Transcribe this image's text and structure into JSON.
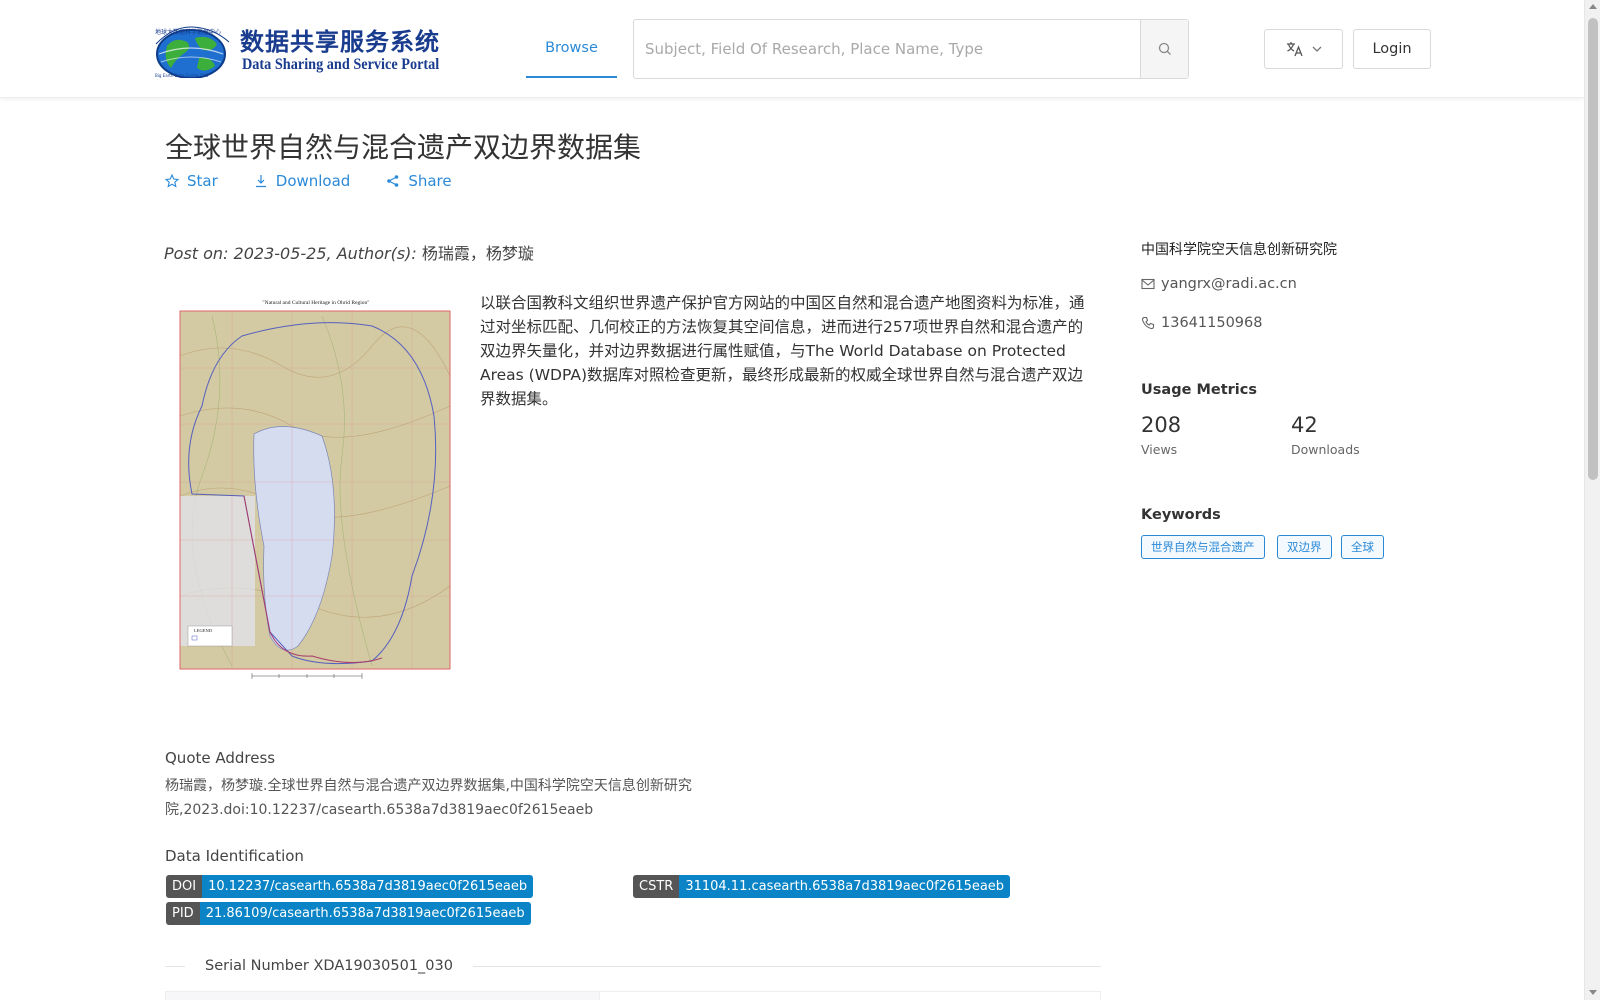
{
  "header": {
    "logo_cn": "数据共享服务系统",
    "logo_en": "Data Sharing and Service Portal",
    "logo_org": "Big Earth Data Center,CAS",
    "logo_org_cn": "地球大数据科学数据中心",
    "nav_browse": "Browse",
    "search_placeholder": "Subject, Field Of Research, Place Name, Type",
    "login": "Login"
  },
  "dataset": {
    "title": "全球世界自然与混合遗产双边界数据集",
    "actions": {
      "star": "Star",
      "download": "Download",
      "share": "Share"
    },
    "post_prefix": "Post on: 2023-05-25, Author(s):",
    "authors": "杨瑞霞，杨梦璇",
    "map_title": "\"Natural and Cultural Heritage in Ohrid Region\"",
    "map_legend": "LEGEND",
    "description": "以联合国教科文组织世界遗产保护官方网站的中国区自然和混合遗产地图资料为标准，通过对坐标匹配、几何校正的方法恢复其空间信息，进而进行257项世界自然和混合遗产的双边界矢量化，并对边界数据进行属性赋值，与The World Database on Protected Areas (WDPA)数据库对照检查更新，最终形成最新的权威全球世界自然与混合遗产双边界数据集。"
  },
  "quote": {
    "label": "Quote Address",
    "text": "杨瑞霞，杨梦璇.全球世界自然与混合遗产双边界数据集,中国科学院空天信息创新研究院,2023.doi:10.12237/casearth.6538a7d3819aec0f2615eaeb"
  },
  "identification": {
    "label": "Data Identification",
    "doi_key": "DOI",
    "doi_value": "10.12237/casearth.6538a7d3819aec0f2615eaeb",
    "cstr_key": "CSTR",
    "cstr_value": "31104.11.casearth.6538a7d3819aec0f2615eaeb",
    "pid_key": "PID",
    "pid_value": "21.86109/casearth.6538a7d3819aec0f2615eaeb",
    "badge_key_color": "#555555",
    "badge_value_color": "#0a84c6"
  },
  "serial": "Serial Number XDA19030501_030",
  "sidebar": {
    "org": "中国科学院空天信息创新研究院",
    "email": "yangrx@radi.ac.cn",
    "phone": "13641150968",
    "metrics_heading": "Usage Metrics",
    "views_value": "208",
    "views_label": "Views",
    "downloads_value": "42",
    "downloads_label": "Downloads",
    "keywords_heading": "Keywords",
    "keywords": [
      "世界自然与混合遗产",
      "双边界",
      "全球"
    ]
  },
  "colors": {
    "accent": "#2b8ad8",
    "logo": "#1a3c8f"
  },
  "icons": {
    "search": "search-icon",
    "language": "translate-icon",
    "chevron": "chevron-down-icon",
    "star": "star-icon",
    "download": "download-icon",
    "share": "share-icon",
    "email": "mail-icon",
    "phone": "phone-icon"
  }
}
